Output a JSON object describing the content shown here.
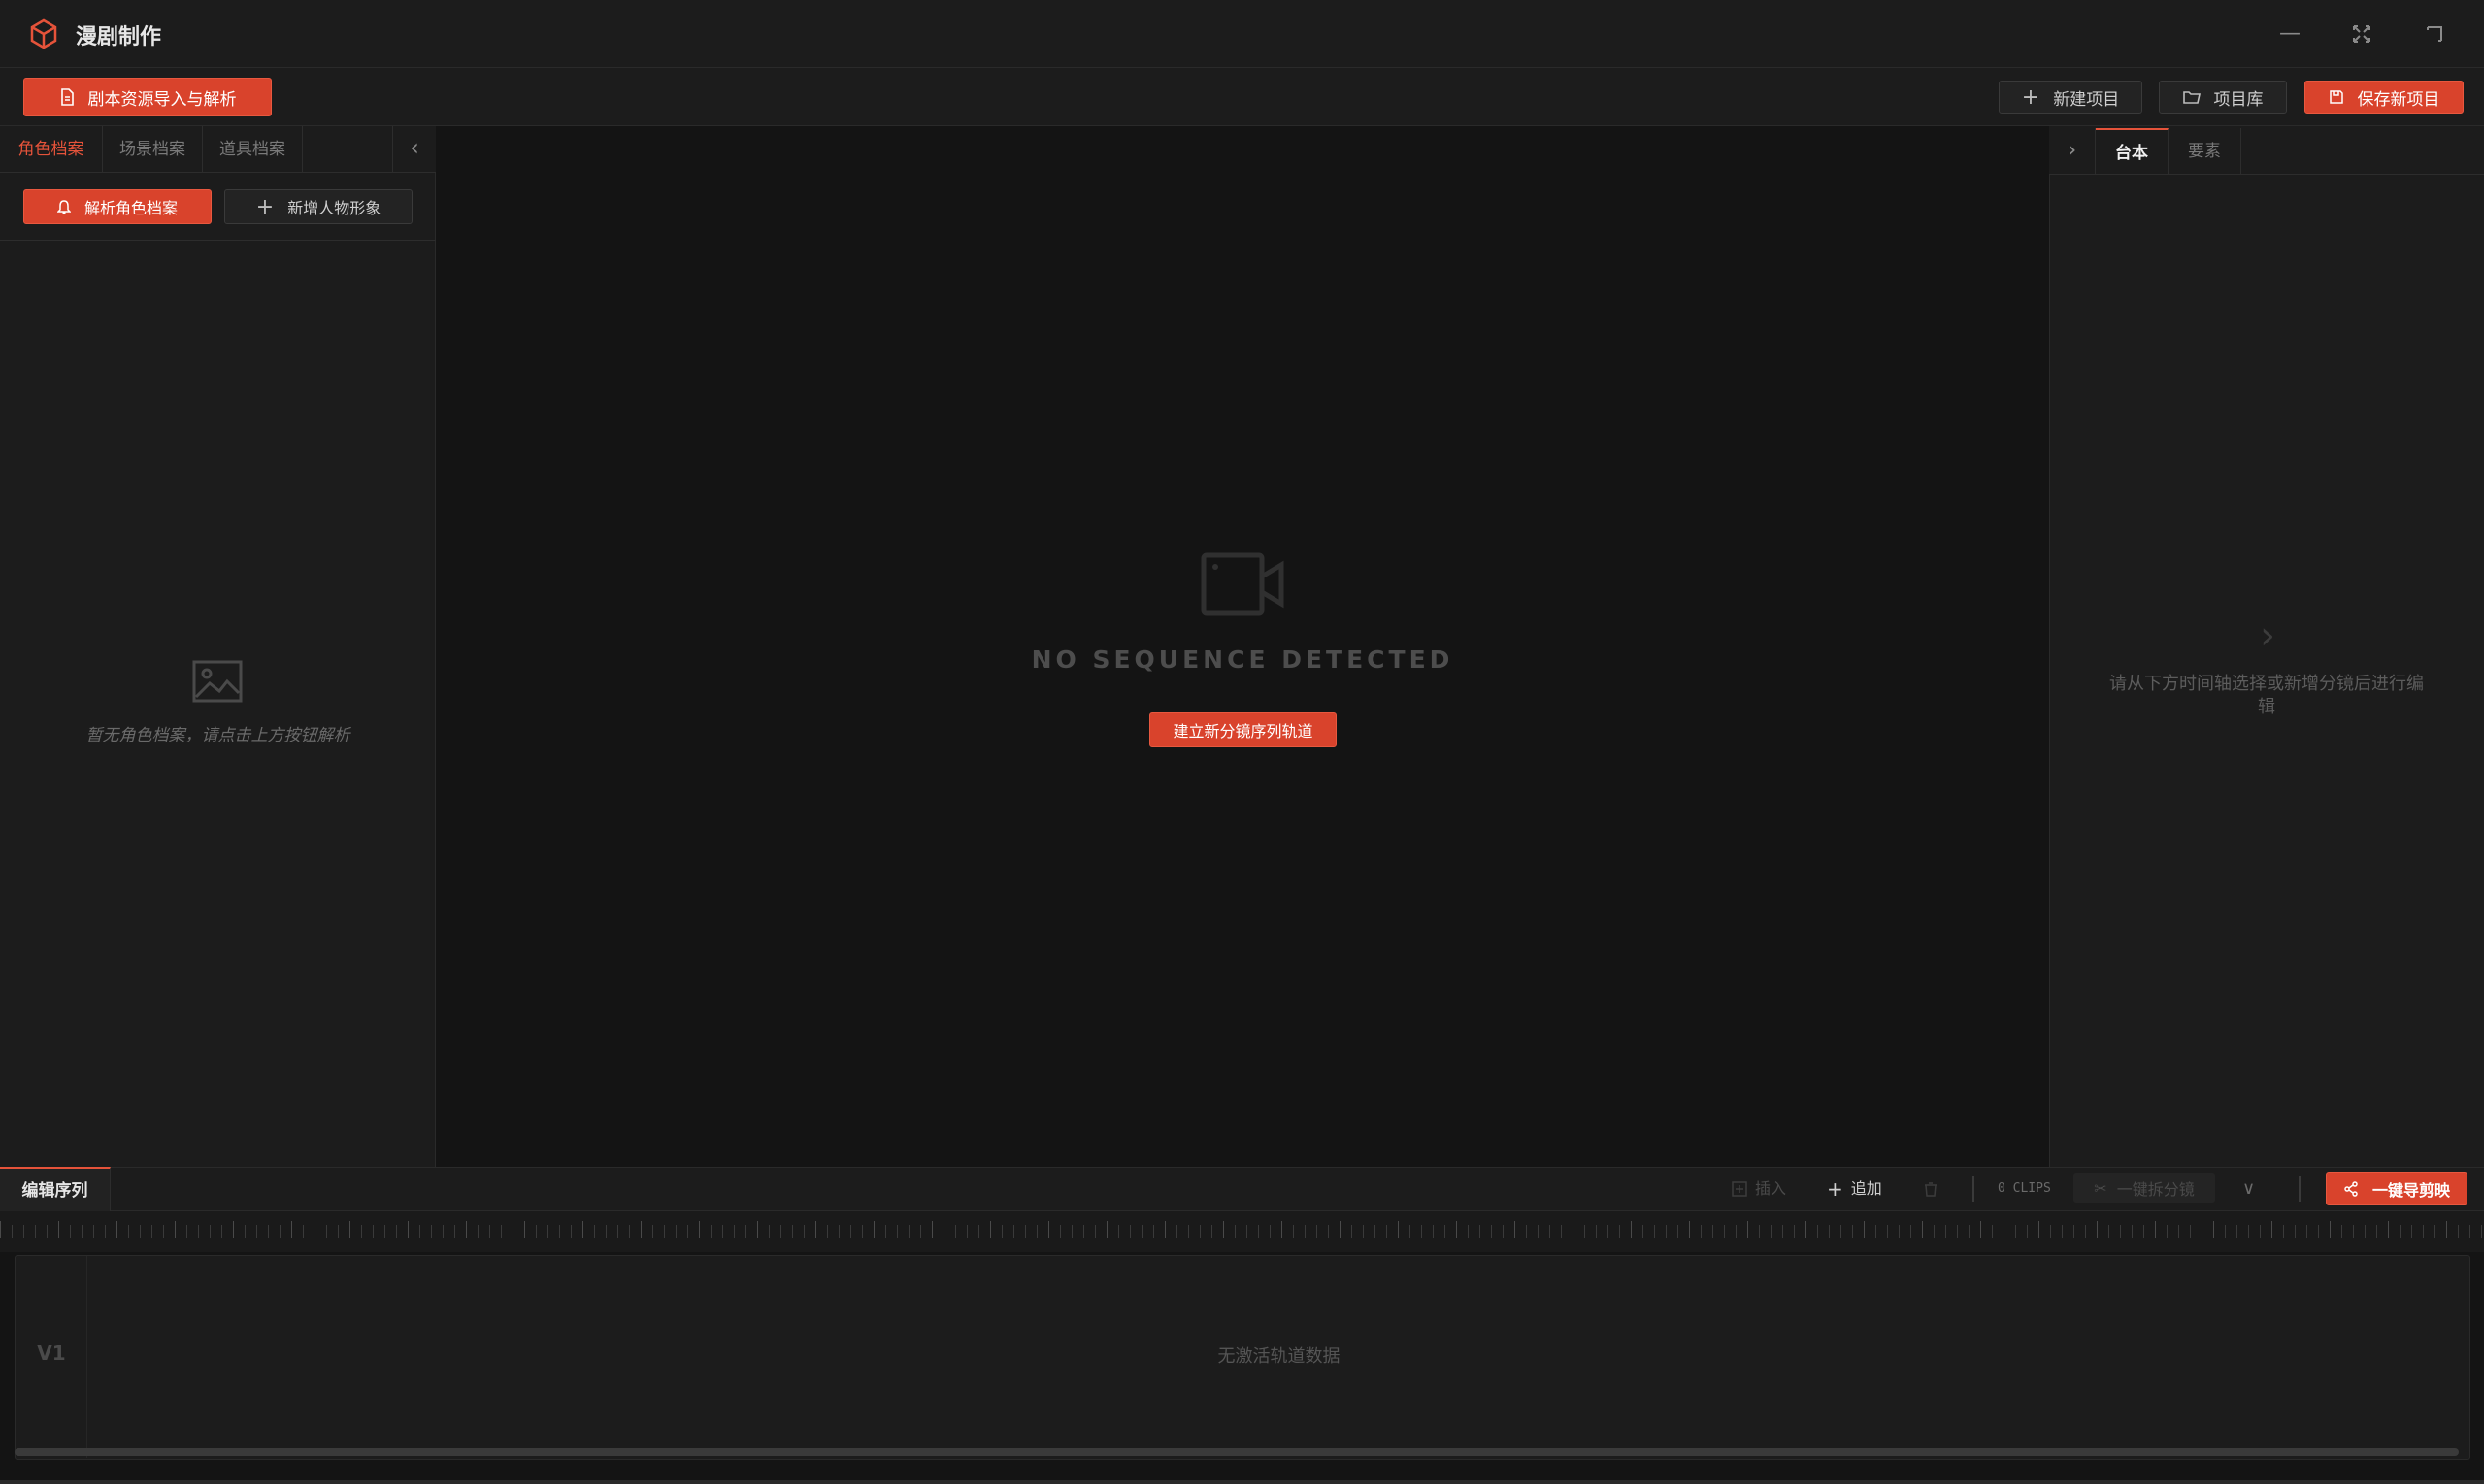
{
  "app": {
    "title": "漫剧制作"
  },
  "toolbar": {
    "import_label": "剧本资源导入与解析",
    "new_project_label": "新建项目",
    "project_library_label": "项目库",
    "save_project_label": "保存新项目"
  },
  "left_panel": {
    "tabs": [
      {
        "label": "角色档案"
      },
      {
        "label": "场景档案"
      },
      {
        "label": "道具档案"
      }
    ],
    "parse_button_label": "解析角色档案",
    "add_button_label": "新增人物形象",
    "empty_text": "暂无角色档案，请点击上方按钮解析"
  },
  "center": {
    "no_sequence_text": "NO SEQUENCE DETECTED",
    "create_button_label": "建立新分镜序列轨道"
  },
  "right_panel": {
    "tabs": [
      {
        "label": "台本"
      },
      {
        "label": "要素"
      }
    ],
    "hint_text": "请从下方时间轴选择或新增分镜后进行编辑"
  },
  "timeline": {
    "tab_label": "编辑序列",
    "insert_label": "插入",
    "append_label": "追加",
    "clips_count": "0 CLIPS",
    "split_label": "一键拆分镜",
    "export_label": "一键导剪映",
    "track_label": "V1",
    "empty_text": "无激活轨道数据"
  },
  "colors": {
    "accent": "#d9432c",
    "background": "#141414",
    "panel": "#1c1c1c"
  }
}
